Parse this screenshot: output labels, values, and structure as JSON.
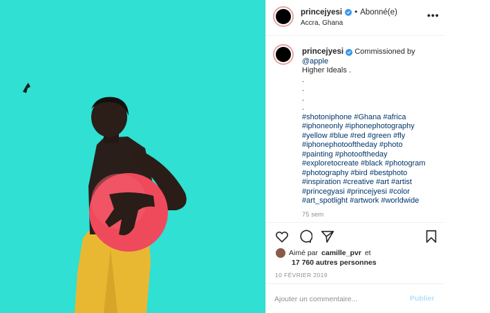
{
  "post": {
    "username": "princejyesi",
    "follow_status": "Abonné(e)",
    "location": "Accra, Ghana",
    "more_label": "•••",
    "colors": {
      "photo_bg": "#2fe0d3",
      "verified": "#3897f0",
      "hashtag": "#003569",
      "publish": "#b2dffc"
    }
  },
  "caption": {
    "username": "princejyesi",
    "lines": [
      "Commissioned by",
      "@apple",
      "Higher Ideals .",
      ".",
      ".",
      ".",
      ".",
      "#shotoniphone #Ghana #africa",
      "#iphoneonly #iphonephotography",
      "#yellow #blue #red #green #fly",
      "#iphonephotooftheday #photo",
      "#painting #photooftheday",
      "#exploretocreate #black #photogram",
      "#photography #bird #bestphoto",
      "#inspiration #creative #art #artist",
      "#princegyasi #princejyesi #color",
      "#art_spotlight #artwork #worldwide"
    ],
    "time_ago": "75 sem"
  },
  "likes": {
    "prefix": "Aimé par",
    "user": "camille_pvr",
    "suffix": "et",
    "others": "17 760 autres personnes"
  },
  "date": "10 FÉVRIER 2019",
  "comment": {
    "placeholder": "Ajouter un commentaire...",
    "publish_label": "Publier"
  }
}
